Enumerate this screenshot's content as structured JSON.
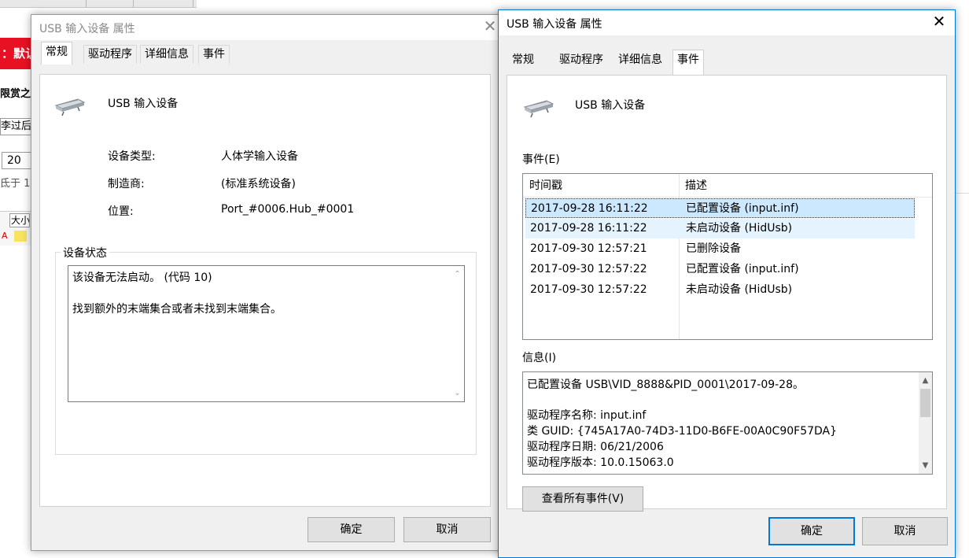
{
  "background": {
    "red_banner_text": "：默认",
    "text_lines": [
      "限赏之后",
      "李过后",
      "氐于 1"
    ],
    "input_value": "20",
    "toolbar_label": "大小"
  },
  "dialog_left": {
    "title": "USB 输入设备 属性",
    "close_glyph": "✕",
    "tabs": [
      "常规",
      "驱动程序",
      "详细信息",
      "事件"
    ],
    "active_tab": "常规",
    "device_name": "USB 输入设备",
    "props": [
      {
        "label": "设备类型:",
        "value": "人体学输入设备"
      },
      {
        "label": "制造商:",
        "value": "(标准系统设备)"
      },
      {
        "label": "位置:",
        "value": "Port_#0006.Hub_#0001"
      }
    ],
    "status_group_label": "设备状态",
    "status_lines": [
      "该设备无法启动。 (代码 10)",
      "",
      "找到额外的末端集合或者未找到末端集合。"
    ],
    "ok_label": "确定",
    "cancel_label": "取消"
  },
  "dialog_right": {
    "title": "USB 输入设备 属性",
    "close_glyph": "✕",
    "tabs": [
      "常规",
      "驱动程序",
      "详细信息",
      "事件"
    ],
    "active_tab": "事件",
    "device_name": "USB 输入设备",
    "events_label": "事件(E)",
    "events_columns": [
      "时间戳",
      "描述"
    ],
    "events": [
      {
        "time": "2017-09-28 16:11:22",
        "desc": "已配置设备 (input.inf)"
      },
      {
        "time": "2017-09-28 16:11:22",
        "desc": "未启动设备 (HidUsb)"
      },
      {
        "time": "2017-09-30 12:57:21",
        "desc": "已删除设备"
      },
      {
        "time": "2017-09-30 12:57:22",
        "desc": "已配置设备 (input.inf)"
      },
      {
        "time": "2017-09-30 12:57:22",
        "desc": "未启动设备 (HidUsb)"
      }
    ],
    "info_label": "信息(I)",
    "info_lines": [
      "已配置设备 USB\\VID_8888&PID_0001\\2017-09-28。",
      "",
      "驱动程序名称: input.inf",
      "类 GUID: {745A17A0-74D3-11D0-B6FE-00A0C90F57DA}",
      "驱动程序日期: 06/21/2006",
      "驱动程序版本: 10.0.15063.0"
    ],
    "view_all_label": "查看所有事件(V)",
    "ok_label": "确定",
    "cancel_label": "取消"
  },
  "colors": {
    "accent": "#0078d7",
    "selection": "#cce8ff",
    "hover": "#e5f3ff",
    "banner_red": "#e81123"
  },
  "icons": {
    "device": "usb-device-icon",
    "close": "close-icon",
    "scroll_up": "scroll-up-arrow-icon",
    "scroll_down": "scroll-down-arrow-icon"
  }
}
